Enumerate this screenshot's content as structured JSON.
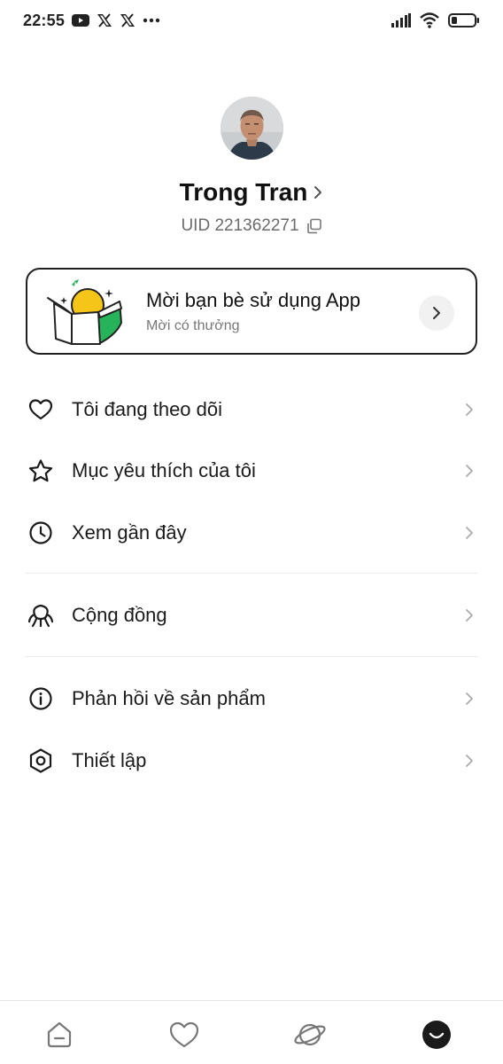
{
  "status_bar": {
    "time": "22:55",
    "left_icons": [
      "youtube-icon",
      "x-icon",
      "x-icon",
      "more-dots-icon"
    ],
    "right_icons": [
      "signal-icon",
      "wifi-icon",
      "battery-icon"
    ]
  },
  "profile": {
    "name": "Trong Tran",
    "uid": "UID 221362271"
  },
  "invite": {
    "title": "Mời bạn bè sử dụng App",
    "subtitle": "Mời có thưởng",
    "accent_green": "#27b35a",
    "accent_yellow": "#f5c518"
  },
  "menu": {
    "following": "Tôi đang theo dõi",
    "favorites": "Mục yêu thích của tôi",
    "recent": "Xem gần đây",
    "community": "Cộng đồng",
    "feedback": "Phản hồi về sản phẩm",
    "settings": "Thiết lập"
  },
  "bottom_nav": {
    "items": [
      "home-icon",
      "heart-icon",
      "planet-icon",
      "profile-icon"
    ],
    "active": "profile-icon"
  }
}
